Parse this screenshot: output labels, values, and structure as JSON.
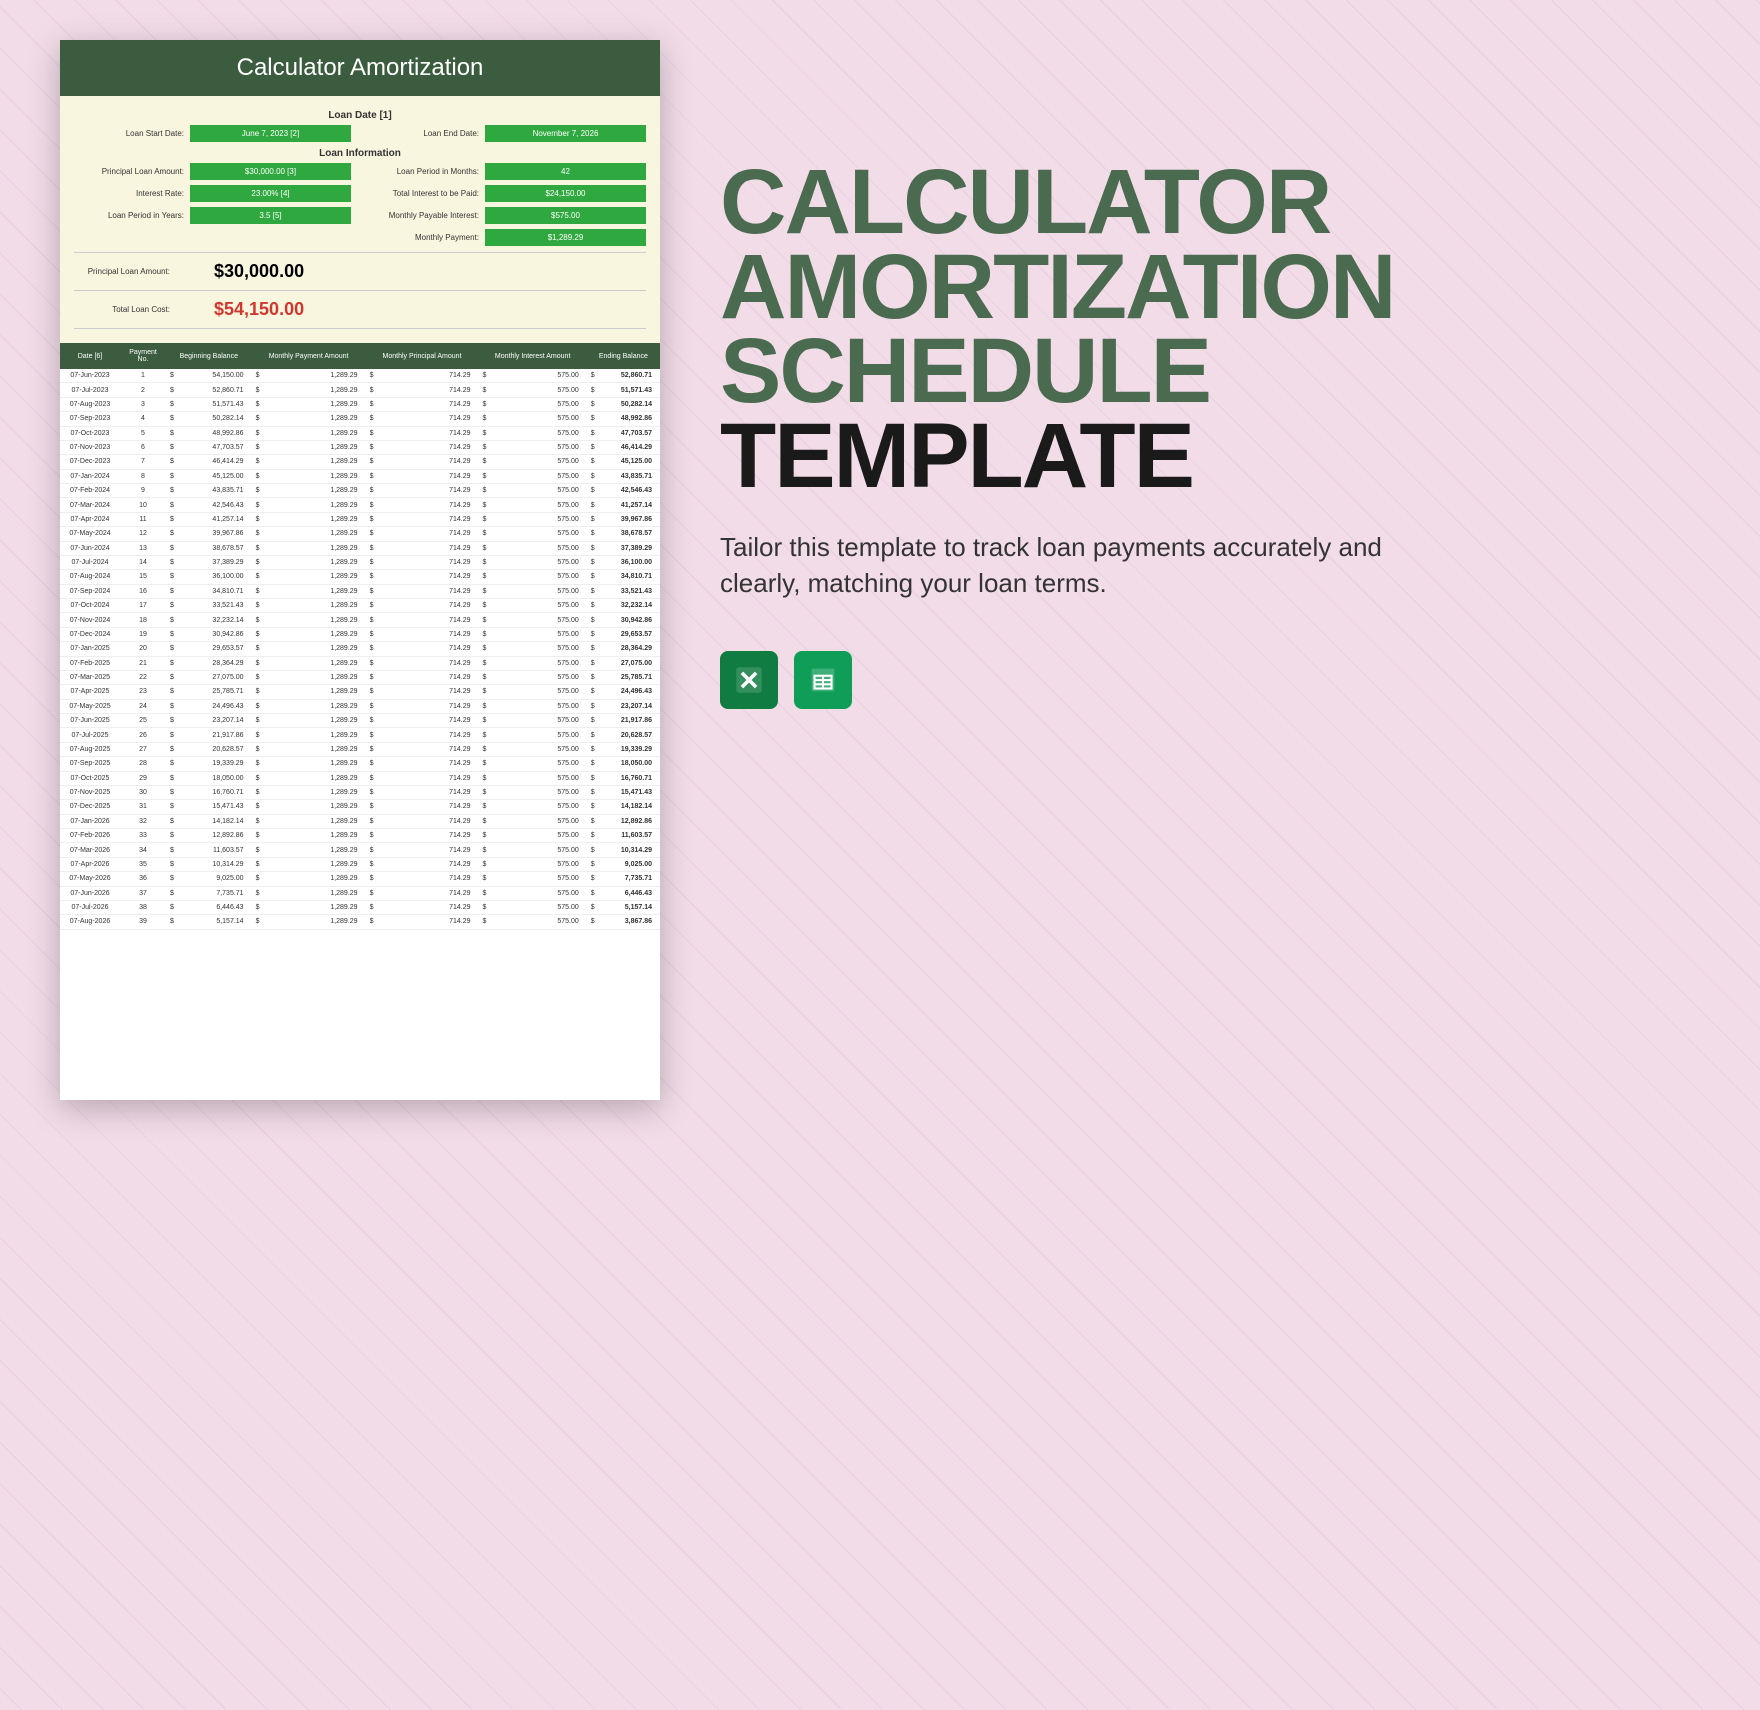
{
  "promo": {
    "title_line1": "CALCULATOR",
    "title_line2": "AMORTIZATION",
    "title_line3": "SCHEDULE",
    "title_line4": "TEMPLATE",
    "subtitle": "Tailor this template to track loan payments accurately and clearly, matching your loan terms.",
    "icons": {
      "excel": "excel-icon",
      "sheets": "google-sheets-icon"
    }
  },
  "doc": {
    "header": "Calculator Amortization",
    "loan_date_section": "Loan Date [1]",
    "loan_info_section": "Loan Information",
    "fields_left_date": [
      {
        "label": "Loan Start Date:",
        "value": "June 7, 2023 [2]"
      }
    ],
    "fields_right_date": [
      {
        "label": "Loan End Date:",
        "value": "November 7, 2026"
      }
    ],
    "fields_left_info": [
      {
        "label": "Principal Loan Amount:",
        "value": "$30,000.00 [3]"
      },
      {
        "label": "Interest Rate:",
        "value": "23.00% [4]"
      },
      {
        "label": "Loan Period in Years:",
        "value": "3.5 [5]"
      }
    ],
    "fields_right_info": [
      {
        "label": "Loan Period in Months:",
        "value": "42"
      },
      {
        "label": "Total Interest to be Paid:",
        "value": "$24,150.00"
      },
      {
        "label": "Monthly Payable Interest:",
        "value": "$575.00"
      },
      {
        "label": "Monthly Payment:",
        "value": "$1,289.29"
      }
    ],
    "summary": {
      "principal_label": "Principal Loan Amount:",
      "principal_value": "$30,000.00",
      "total_label": "Total Loan Cost:",
      "total_value": "$54,150.00"
    },
    "table": {
      "headers": [
        "Date [6]",
        "Payment No.",
        "Beginning Balance",
        "Monthly Payment Amount",
        "Monthly Principal Amount",
        "Monthly Interest Amount",
        "Ending Balance"
      ],
      "currency": "$",
      "rows": [
        {
          "date": "07-Jun-2023",
          "n": 1,
          "beg": "54,150.00",
          "pay": "1,289.29",
          "prin": "714.29",
          "int": "575.00",
          "end": "52,860.71"
        },
        {
          "date": "07-Jul-2023",
          "n": 2,
          "beg": "52,860.71",
          "pay": "1,289.29",
          "prin": "714.29",
          "int": "575.00",
          "end": "51,571.43"
        },
        {
          "date": "07-Aug-2023",
          "n": 3,
          "beg": "51,571.43",
          "pay": "1,289.29",
          "prin": "714.29",
          "int": "575.00",
          "end": "50,282.14"
        },
        {
          "date": "07-Sep-2023",
          "n": 4,
          "beg": "50,282.14",
          "pay": "1,289.29",
          "prin": "714.29",
          "int": "575.00",
          "end": "48,992.86"
        },
        {
          "date": "07-Oct-2023",
          "n": 5,
          "beg": "48,992.86",
          "pay": "1,289.29",
          "prin": "714.29",
          "int": "575.00",
          "end": "47,703.57"
        },
        {
          "date": "07-Nov-2023",
          "n": 6,
          "beg": "47,703.57",
          "pay": "1,289.29",
          "prin": "714.29",
          "int": "575.00",
          "end": "46,414.29"
        },
        {
          "date": "07-Dec-2023",
          "n": 7,
          "beg": "46,414.29",
          "pay": "1,289.29",
          "prin": "714.29",
          "int": "575.00",
          "end": "45,125.00"
        },
        {
          "date": "07-Jan-2024",
          "n": 8,
          "beg": "45,125.00",
          "pay": "1,289.29",
          "prin": "714.29",
          "int": "575.00",
          "end": "43,835.71"
        },
        {
          "date": "07-Feb-2024",
          "n": 9,
          "beg": "43,835.71",
          "pay": "1,289.29",
          "prin": "714.29",
          "int": "575.00",
          "end": "42,546.43"
        },
        {
          "date": "07-Mar-2024",
          "n": 10,
          "beg": "42,546.43",
          "pay": "1,289.29",
          "prin": "714.29",
          "int": "575.00",
          "end": "41,257.14"
        },
        {
          "date": "07-Apr-2024",
          "n": 11,
          "beg": "41,257.14",
          "pay": "1,289.29",
          "prin": "714.29",
          "int": "575.00",
          "end": "39,967.86"
        },
        {
          "date": "07-May-2024",
          "n": 12,
          "beg": "39,967.86",
          "pay": "1,289.29",
          "prin": "714.29",
          "int": "575.00",
          "end": "38,678.57"
        },
        {
          "date": "07-Jun-2024",
          "n": 13,
          "beg": "38,678.57",
          "pay": "1,289.29",
          "prin": "714.29",
          "int": "575.00",
          "end": "37,389.29"
        },
        {
          "date": "07-Jul-2024",
          "n": 14,
          "beg": "37,389.29",
          "pay": "1,289.29",
          "prin": "714.29",
          "int": "575.00",
          "end": "36,100.00"
        },
        {
          "date": "07-Aug-2024",
          "n": 15,
          "beg": "36,100.00",
          "pay": "1,289.29",
          "prin": "714.29",
          "int": "575.00",
          "end": "34,810.71"
        },
        {
          "date": "07-Sep-2024",
          "n": 16,
          "beg": "34,810.71",
          "pay": "1,289.29",
          "prin": "714.29",
          "int": "575.00",
          "end": "33,521.43"
        },
        {
          "date": "07-Oct-2024",
          "n": 17,
          "beg": "33,521.43",
          "pay": "1,289.29",
          "prin": "714.29",
          "int": "575.00",
          "end": "32,232.14"
        },
        {
          "date": "07-Nov-2024",
          "n": 18,
          "beg": "32,232.14",
          "pay": "1,289.29",
          "prin": "714.29",
          "int": "575.00",
          "end": "30,942.86"
        },
        {
          "date": "07-Dec-2024",
          "n": 19,
          "beg": "30,942.86",
          "pay": "1,289.29",
          "prin": "714.29",
          "int": "575.00",
          "end": "29,653.57"
        },
        {
          "date": "07-Jan-2025",
          "n": 20,
          "beg": "29,653.57",
          "pay": "1,289.29",
          "prin": "714.29",
          "int": "575.00",
          "end": "28,364.29"
        },
        {
          "date": "07-Feb-2025",
          "n": 21,
          "beg": "28,364.29",
          "pay": "1,289.29",
          "prin": "714.29",
          "int": "575.00",
          "end": "27,075.00"
        },
        {
          "date": "07-Mar-2025",
          "n": 22,
          "beg": "27,075.00",
          "pay": "1,289.29",
          "prin": "714.29",
          "int": "575.00",
          "end": "25,785.71"
        },
        {
          "date": "07-Apr-2025",
          "n": 23,
          "beg": "25,785.71",
          "pay": "1,289.29",
          "prin": "714.29",
          "int": "575.00",
          "end": "24,496.43"
        },
        {
          "date": "07-May-2025",
          "n": 24,
          "beg": "24,496.43",
          "pay": "1,289.29",
          "prin": "714.29",
          "int": "575.00",
          "end": "23,207.14"
        },
        {
          "date": "07-Jun-2025",
          "n": 25,
          "beg": "23,207.14",
          "pay": "1,289.29",
          "prin": "714.29",
          "int": "575.00",
          "end": "21,917.86"
        },
        {
          "date": "07-Jul-2025",
          "n": 26,
          "beg": "21,917.86",
          "pay": "1,289.29",
          "prin": "714.29",
          "int": "575.00",
          "end": "20,628.57"
        },
        {
          "date": "07-Aug-2025",
          "n": 27,
          "beg": "20,628.57",
          "pay": "1,289.29",
          "prin": "714.29",
          "int": "575.00",
          "end": "19,339.29"
        },
        {
          "date": "07-Sep-2025",
          "n": 28,
          "beg": "19,339.29",
          "pay": "1,289.29",
          "prin": "714.29",
          "int": "575.00",
          "end": "18,050.00"
        },
        {
          "date": "07-Oct-2025",
          "n": 29,
          "beg": "18,050.00",
          "pay": "1,289.29",
          "prin": "714.29",
          "int": "575.00",
          "end": "16,760.71"
        },
        {
          "date": "07-Nov-2025",
          "n": 30,
          "beg": "16,760.71",
          "pay": "1,289.29",
          "prin": "714.29",
          "int": "575.00",
          "end": "15,471.43"
        },
        {
          "date": "07-Dec-2025",
          "n": 31,
          "beg": "15,471.43",
          "pay": "1,289.29",
          "prin": "714.29",
          "int": "575.00",
          "end": "14,182.14"
        },
        {
          "date": "07-Jan-2026",
          "n": 32,
          "beg": "14,182.14",
          "pay": "1,289.29",
          "prin": "714.29",
          "int": "575.00",
          "end": "12,892.86"
        },
        {
          "date": "07-Feb-2026",
          "n": 33,
          "beg": "12,892.86",
          "pay": "1,289.29",
          "prin": "714.29",
          "int": "575.00",
          "end": "11,603.57"
        },
        {
          "date": "07-Mar-2026",
          "n": 34,
          "beg": "11,603.57",
          "pay": "1,289.29",
          "prin": "714.29",
          "int": "575.00",
          "end": "10,314.29"
        },
        {
          "date": "07-Apr-2026",
          "n": 35,
          "beg": "10,314.29",
          "pay": "1,289.29",
          "prin": "714.29",
          "int": "575.00",
          "end": "9,025.00"
        },
        {
          "date": "07-May-2026",
          "n": 36,
          "beg": "9,025.00",
          "pay": "1,289.29",
          "prin": "714.29",
          "int": "575.00",
          "end": "7,735.71"
        },
        {
          "date": "07-Jun-2026",
          "n": 37,
          "beg": "7,735.71",
          "pay": "1,289.29",
          "prin": "714.29",
          "int": "575.00",
          "end": "6,446.43"
        },
        {
          "date": "07-Jul-2026",
          "n": 38,
          "beg": "6,446.43",
          "pay": "1,289.29",
          "prin": "714.29",
          "int": "575.00",
          "end": "5,157.14"
        },
        {
          "date": "07-Aug-2026",
          "n": 39,
          "beg": "5,157.14",
          "pay": "1,289.29",
          "prin": "714.29",
          "int": "575.00",
          "end": "3,867.86"
        }
      ]
    }
  }
}
